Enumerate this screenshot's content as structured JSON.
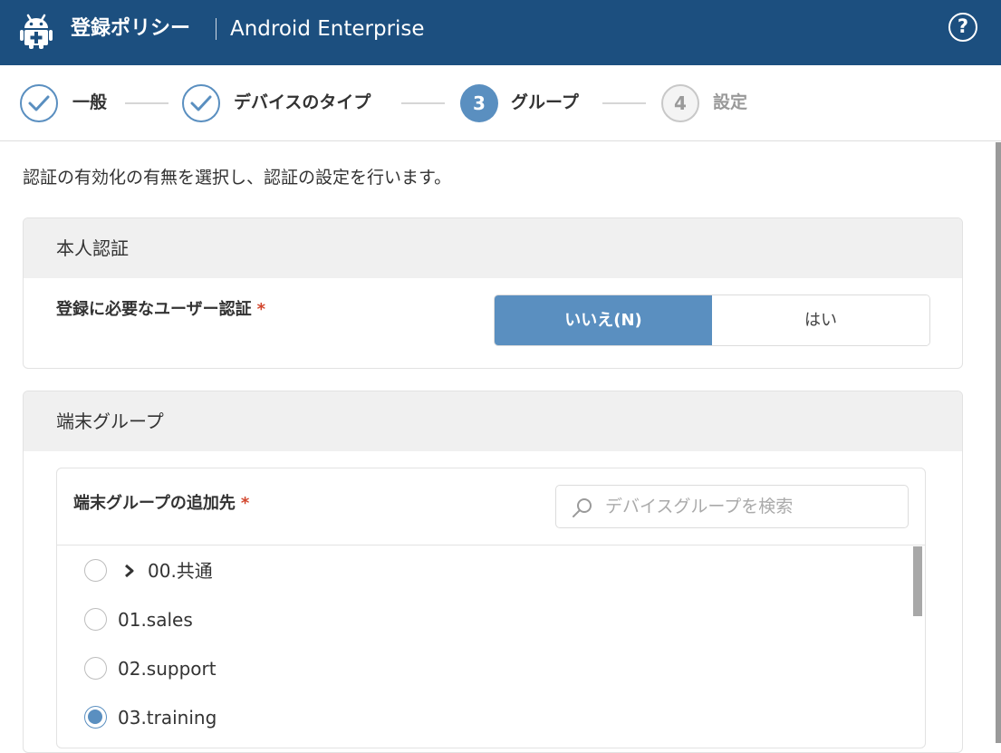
{
  "header": {
    "title": "登録ポリシー",
    "subtitle": "Android Enterprise",
    "help_label": "?",
    "logo_icon": "android-logo-icon",
    "background": "#1c4f7f"
  },
  "stepper": {
    "steps": [
      {
        "number": "1",
        "label": "一般",
        "state": "done"
      },
      {
        "number": "2",
        "label": "デバイスのタイプ",
        "state": "done"
      },
      {
        "number": "3",
        "label": "グループ",
        "state": "active"
      },
      {
        "number": "4",
        "label": "設定",
        "state": "future"
      }
    ],
    "accent": "#5a8fc0"
  },
  "description": "認証の有効化の有無を選択し、認証の設定を行います。",
  "auth_section": {
    "title": "本人認証",
    "field_label": "登録に必要なユーザー認証",
    "required_mark": "*",
    "options": {
      "no": "いいえ(N)",
      "yes": "はい"
    },
    "selected": "no"
  },
  "group_section": {
    "title": "端末グループ",
    "field_label": "端末グループの追加先",
    "required_mark": "*",
    "search": {
      "placeholder": "デバイスグループを検索",
      "value": ""
    },
    "items": [
      {
        "label": "00.共通",
        "expandable": true,
        "selected": false
      },
      {
        "label": "01.sales",
        "expandable": false,
        "selected": false
      },
      {
        "label": "02.support",
        "expandable": false,
        "selected": false
      },
      {
        "label": "03.training",
        "expandable": false,
        "selected": true
      }
    ]
  }
}
